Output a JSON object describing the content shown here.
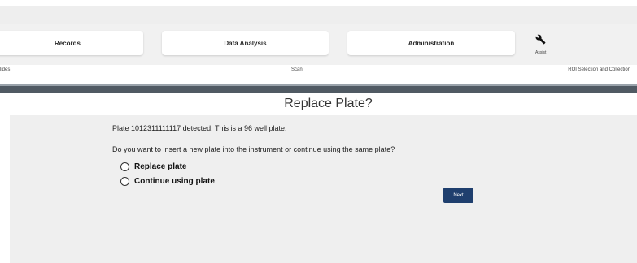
{
  "nav": {
    "records_label": "Records",
    "data_analysis_label": "Data Analysis",
    "administration_label": "Administration",
    "assist_label": "Assist",
    "assist_icon": "wrench-icon"
  },
  "workflow_steps": {
    "slides_label": "lides",
    "scan_label": "Scan",
    "roi_label": "ROI Selection and Collection"
  },
  "dialog": {
    "title": "Replace Plate?",
    "detected_message": "Plate 1012311111117 detected. This is a 96 well plate.",
    "question": "Do you want to insert a new plate into the instrument or continue using the same plate?",
    "options": [
      {
        "label": "Replace plate",
        "selected": false
      },
      {
        "label": "Continue using plate",
        "selected": false
      }
    ],
    "next_label": "Next"
  },
  "colors": {
    "primary_button": "#1f3f6e",
    "progress_bar": "#505a63",
    "content_background": "#efefef"
  }
}
